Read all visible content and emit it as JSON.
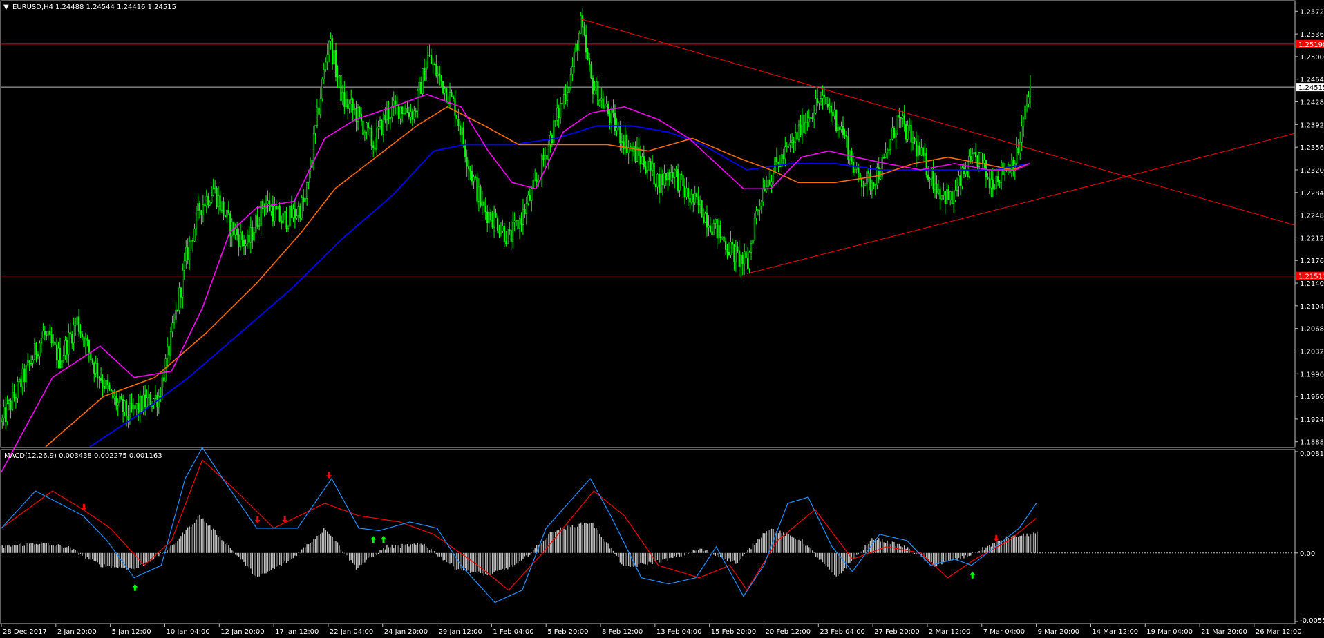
{
  "header": {
    "menu_arrow": "▼",
    "symbol": "EURUSD,H4",
    "ohlc": "1.24488 1.24544 1.24416 1.24515"
  },
  "macd_header": {
    "label": "MACD(12,26,9) 0.003438 0.002275 0.001163"
  },
  "colors": {
    "background": "#000000",
    "candle": "#00ff00",
    "sma_fast": "#ff00ff",
    "sma_mid": "#ff6a00",
    "sma_slow": "#0000ff",
    "levels": "#ff0000",
    "price_line": "#c0c0c0",
    "macd_line": "#1e90ff",
    "signal_line": "#ff0000",
    "histogram": "#c0c0c0",
    "arrow_up": "#00ff00",
    "arrow_down": "#ff0000",
    "axis_text": "#ffffff"
  },
  "chart_data": [
    {
      "type": "candlestick",
      "symbol": "EURUSD",
      "timeframe": "H4",
      "ylim": [
        1.188,
        1.258
      ],
      "price_ticks": [
        "1.25720",
        "1.25360",
        "1.25000",
        "1.24640",
        "1.24280",
        "1.23920",
        "1.23560",
        "1.23200",
        "1.22840",
        "1.22480",
        "1.22120",
        "1.21760",
        "1.21400",
        "1.21040",
        "1.20680",
        "1.20320",
        "1.19960",
        "1.19600",
        "1.19240",
        "1.18880"
      ],
      "time_ticks": [
        "28 Dec 2017",
        "2 Jan 20:00",
        "5 Jan 12:00",
        "10 Jan 04:00",
        "12 Jan 20:00",
        "17 Jan 12:00",
        "22 Jan 04:00",
        "24 Jan 20:00",
        "29 Jan 12:00",
        "1 Feb 04:00",
        "5 Feb 20:00",
        "8 Feb 12:00",
        "13 Feb 04:00",
        "15 Feb 20:00",
        "20 Feb 12:00",
        "23 Feb 04:00",
        "27 Feb 20:00",
        "2 Mar 12:00",
        "7 Mar 04:00",
        "9 Mar 20:00",
        "14 Mar 12:00",
        "19 Mar 04:00",
        "21 Mar 20:00",
        "26 Mar 12:00"
      ],
      "price_path": [
        [
          0,
          1.192
        ],
        [
          16,
          1.201
        ],
        [
          24,
          1.206
        ],
        [
          34,
          1.202
        ],
        [
          44,
          1.208
        ],
        [
          54,
          1.201
        ],
        [
          64,
          1.196
        ],
        [
          74,
          1.193
        ],
        [
          84,
          1.195
        ],
        [
          92,
          1.196
        ],
        [
          100,
          1.206
        ],
        [
          108,
          1.218
        ],
        [
          116,
          1.226
        ],
        [
          124,
          1.229
        ],
        [
          134,
          1.223
        ],
        [
          144,
          1.22
        ],
        [
          154,
          1.227
        ],
        [
          164,
          1.224
        ],
        [
          172,
          1.225
        ],
        [
          178,
          1.227
        ],
        [
          186,
          1.242
        ],
        [
          192,
          1.253
        ],
        [
          200,
          1.243
        ],
        [
          208,
          1.241
        ],
        [
          218,
          1.236
        ],
        [
          226,
          1.241
        ],
        [
          234,
          1.242
        ],
        [
          242,
          1.241
        ],
        [
          250,
          1.25
        ],
        [
          258,
          1.246
        ],
        [
          266,
          1.242
        ],
        [
          274,
          1.233
        ],
        [
          282,
          1.226
        ],
        [
          290,
          1.224
        ],
        [
          298,
          1.221
        ],
        [
          306,
          1.225
        ],
        [
          314,
          1.23
        ],
        [
          322,
          1.237
        ],
        [
          328,
          1.242
        ],
        [
          334,
          1.247
        ],
        [
          340,
          1.255
        ],
        [
          346,
          1.246
        ],
        [
          354,
          1.242
        ],
        [
          362,
          1.238
        ],
        [
          370,
          1.235
        ],
        [
          378,
          1.233
        ],
        [
          386,
          1.23
        ],
        [
          394,
          1.232
        ],
        [
          402,
          1.228
        ],
        [
          410,
          1.226
        ],
        [
          418,
          1.223
        ],
        [
          426,
          1.22
        ],
        [
          432,
          1.218
        ],
        [
          438,
          1.217
        ],
        [
          442,
          1.224
        ],
        [
          448,
          1.23
        ],
        [
          456,
          1.233
        ],
        [
          464,
          1.236
        ],
        [
          472,
          1.24
        ],
        [
          480,
          1.243
        ],
        [
          486,
          1.242
        ],
        [
          494,
          1.238
        ],
        [
          502,
          1.231
        ],
        [
          510,
          1.23
        ],
        [
          518,
          1.233
        ],
        [
          526,
          1.24
        ],
        [
          534,
          1.237
        ],
        [
          542,
          1.233
        ],
        [
          550,
          1.229
        ],
        [
          558,
          1.227
        ],
        [
          566,
          1.232
        ],
        [
          574,
          1.234
        ],
        [
          580,
          1.23
        ],
        [
          588,
          1.232
        ],
        [
          596,
          1.234
        ],
        [
          604,
          1.2451
        ]
      ],
      "sma_fast": [
        [
          0,
          1.184
        ],
        [
          30,
          1.199
        ],
        [
          58,
          1.204
        ],
        [
          78,
          1.199
        ],
        [
          100,
          1.2
        ],
        [
          118,
          1.21
        ],
        [
          134,
          1.222
        ],
        [
          150,
          1.226
        ],
        [
          172,
          1.227
        ],
        [
          190,
          1.237
        ],
        [
          208,
          1.24
        ],
        [
          230,
          1.242
        ],
        [
          250,
          1.244
        ],
        [
          270,
          1.242
        ],
        [
          286,
          1.235
        ],
        [
          300,
          1.23
        ],
        [
          314,
          1.229
        ],
        [
          330,
          1.238
        ],
        [
          346,
          1.241
        ],
        [
          366,
          1.242
        ],
        [
          386,
          1.24
        ],
        [
          404,
          1.237
        ],
        [
          420,
          1.233
        ],
        [
          436,
          1.229
        ],
        [
          452,
          1.229
        ],
        [
          470,
          1.234
        ],
        [
          486,
          1.235
        ],
        [
          502,
          1.234
        ],
        [
          520,
          1.233
        ],
        [
          540,
          1.232
        ],
        [
          560,
          1.233
        ],
        [
          580,
          1.232
        ],
        [
          596,
          1.232
        ],
        [
          604,
          1.233
        ]
      ],
      "sma_mid": [
        [
          26,
          1.188
        ],
        [
          60,
          1.196
        ],
        [
          90,
          1.199
        ],
        [
          120,
          1.206
        ],
        [
          150,
          1.214
        ],
        [
          176,
          1.222
        ],
        [
          196,
          1.229
        ],
        [
          220,
          1.234
        ],
        [
          244,
          1.239
        ],
        [
          262,
          1.242
        ],
        [
          284,
          1.239
        ],
        [
          304,
          1.236
        ],
        [
          330,
          1.236
        ],
        [
          356,
          1.236
        ],
        [
          380,
          1.235
        ],
        [
          406,
          1.237
        ],
        [
          432,
          1.234
        ],
        [
          452,
          1.232
        ],
        [
          468,
          1.23
        ],
        [
          490,
          1.23
        ],
        [
          514,
          1.231
        ],
        [
          536,
          1.233
        ],
        [
          556,
          1.234
        ],
        [
          576,
          1.233
        ],
        [
          594,
          1.232
        ],
        [
          604,
          1.233
        ]
      ],
      "sma_slow": [
        [
          52,
          1.188
        ],
        [
          80,
          1.193
        ],
        [
          110,
          1.199
        ],
        [
          140,
          1.206
        ],
        [
          170,
          1.213
        ],
        [
          200,
          1.221
        ],
        [
          230,
          1.228
        ],
        [
          254,
          1.235
        ],
        [
          272,
          1.236
        ],
        [
          300,
          1.236
        ],
        [
          326,
          1.237
        ],
        [
          350,
          1.239
        ],
        [
          370,
          1.239
        ],
        [
          392,
          1.238
        ],
        [
          412,
          1.236
        ],
        [
          438,
          1.232
        ],
        [
          464,
          1.233
        ],
        [
          490,
          1.233
        ],
        [
          516,
          1.232
        ],
        [
          540,
          1.232
        ],
        [
          566,
          1.232
        ],
        [
          584,
          1.232
        ],
        [
          604,
          1.233
        ]
      ],
      "horizontal_levels": [
        {
          "price": 1.25198,
          "label": "1.25198"
        },
        {
          "price": 1.21513,
          "label": "1.21513"
        }
      ],
      "current_price": {
        "price": 1.24515,
        "label": "1.24515"
      },
      "trendlines": [
        {
          "from": [
            340,
            1.256
          ],
          "to": [
            760,
            1.2232
          ]
        },
        {
          "from": [
            438,
            1.2155
          ],
          "to": [
            760,
            1.2378
          ]
        }
      ]
    },
    {
      "type": "macd",
      "params": "12,26,9",
      "macd_value": 0.003438,
      "signal_value": 0.002275,
      "histogram_value": 0.001163,
      "ylim": [
        -0.005525,
        0.008173
      ],
      "axis_ticks": [
        "0.008173",
        "0.00",
        "-0.005525"
      ],
      "macd_path": [
        [
          0,
          0.002
        ],
        [
          20,
          0.005
        ],
        [
          34,
          0.004
        ],
        [
          48,
          0.003
        ],
        [
          62,
          0.001
        ],
        [
          78,
          -0.002
        ],
        [
          94,
          -0.001
        ],
        [
          108,
          0.006
        ],
        [
          118,
          0.0085
        ],
        [
          130,
          0.006
        ],
        [
          150,
          0.002
        ],
        [
          174,
          0.002
        ],
        [
          194,
          0.006
        ],
        [
          210,
          0.002
        ],
        [
          222,
          0.0018
        ],
        [
          240,
          0.0025
        ],
        [
          256,
          0.002
        ],
        [
          270,
          -0.001
        ],
        [
          290,
          -0.004
        ],
        [
          306,
          -0.003
        ],
        [
          320,
          0.002
        ],
        [
          346,
          0.006
        ],
        [
          358,
          0.003
        ],
        [
          376,
          -0.002
        ],
        [
          392,
          -0.0025
        ],
        [
          408,
          -0.002
        ],
        [
          420,
          0.0005
        ],
        [
          436,
          -0.0035
        ],
        [
          448,
          -0.001
        ],
        [
          462,
          0.004
        ],
        [
          474,
          0.0045
        ],
        [
          488,
          0.0005
        ],
        [
          500,
          -0.0015
        ],
        [
          516,
          0.0015
        ],
        [
          532,
          0.001
        ],
        [
          546,
          -0.001
        ],
        [
          560,
          -0.0005
        ],
        [
          570,
          -0.001
        ],
        [
          584,
          0.0005
        ],
        [
          598,
          0.002
        ],
        [
          608,
          0.004
        ]
      ],
      "signal_path": [
        [
          0,
          0.002
        ],
        [
          30,
          0.005
        ],
        [
          48,
          0.0035
        ],
        [
          64,
          0.002
        ],
        [
          84,
          -0.001
        ],
        [
          100,
          0.001
        ],
        [
          118,
          0.0075
        ],
        [
          138,
          0.005
        ],
        [
          160,
          0.002
        ],
        [
          190,
          0.004
        ],
        [
          210,
          0.003
        ],
        [
          234,
          0.0025
        ],
        [
          254,
          0.0015
        ],
        [
          280,
          -0.001
        ],
        [
          298,
          -0.003
        ],
        [
          318,
          0.0
        ],
        [
          348,
          0.005
        ],
        [
          366,
          0.003
        ],
        [
          386,
          -0.001
        ],
        [
          410,
          -0.002
        ],
        [
          428,
          -0.001
        ],
        [
          438,
          -0.003
        ],
        [
          456,
          0.001
        ],
        [
          478,
          0.0035
        ],
        [
          500,
          -0.0005
        ],
        [
          520,
          0.0005
        ],
        [
          540,
          0.0
        ],
        [
          556,
          -0.002
        ],
        [
          572,
          -0.0005
        ],
        [
          592,
          0.001
        ],
        [
          608,
          0.0028
        ]
      ],
      "histogram_path": [
        [
          0,
          0.0005
        ],
        [
          20,
          0.0008
        ],
        [
          38,
          0.0005
        ],
        [
          58,
          -0.001
        ],
        [
          78,
          -0.0013
        ],
        [
          98,
          0.0003
        ],
        [
          116,
          0.003
        ],
        [
          132,
          0.0007
        ],
        [
          150,
          -0.002
        ],
        [
          170,
          -0.0005
        ],
        [
          190,
          0.002
        ],
        [
          208,
          -0.0012
        ],
        [
          226,
          0.0005
        ],
        [
          248,
          0.0007
        ],
        [
          266,
          -0.0012
        ],
        [
          286,
          -0.0018
        ],
        [
          304,
          -0.0008
        ],
        [
          324,
          0.0018
        ],
        [
          346,
          0.0025
        ],
        [
          366,
          -0.0012
        ],
        [
          392,
          -0.0005
        ],
        [
          410,
          0.0003
        ],
        [
          432,
          -0.0008
        ],
        [
          450,
          0.002
        ],
        [
          470,
          0.001
        ],
        [
          490,
          -0.002
        ],
        [
          512,
          0.0012
        ],
        [
          530,
          0.0005
        ],
        [
          548,
          -0.001
        ],
        [
          566,
          -0.0003
        ],
        [
          590,
          0.0012
        ],
        [
          608,
          0.0016
        ]
      ],
      "signal_arrows": [
        {
          "x": 48,
          "dir": "down"
        },
        {
          "x": 78,
          "dir": "up"
        },
        {
          "x": 150,
          "dir": "down"
        },
        {
          "x": 166,
          "dir": "down"
        },
        {
          "x": 192,
          "dir": "down"
        },
        {
          "x": 218,
          "dir": "up"
        },
        {
          "x": 224,
          "dir": "up"
        },
        {
          "x": 570,
          "dir": "up"
        },
        {
          "x": 584,
          "dir": "down"
        }
      ]
    }
  ]
}
